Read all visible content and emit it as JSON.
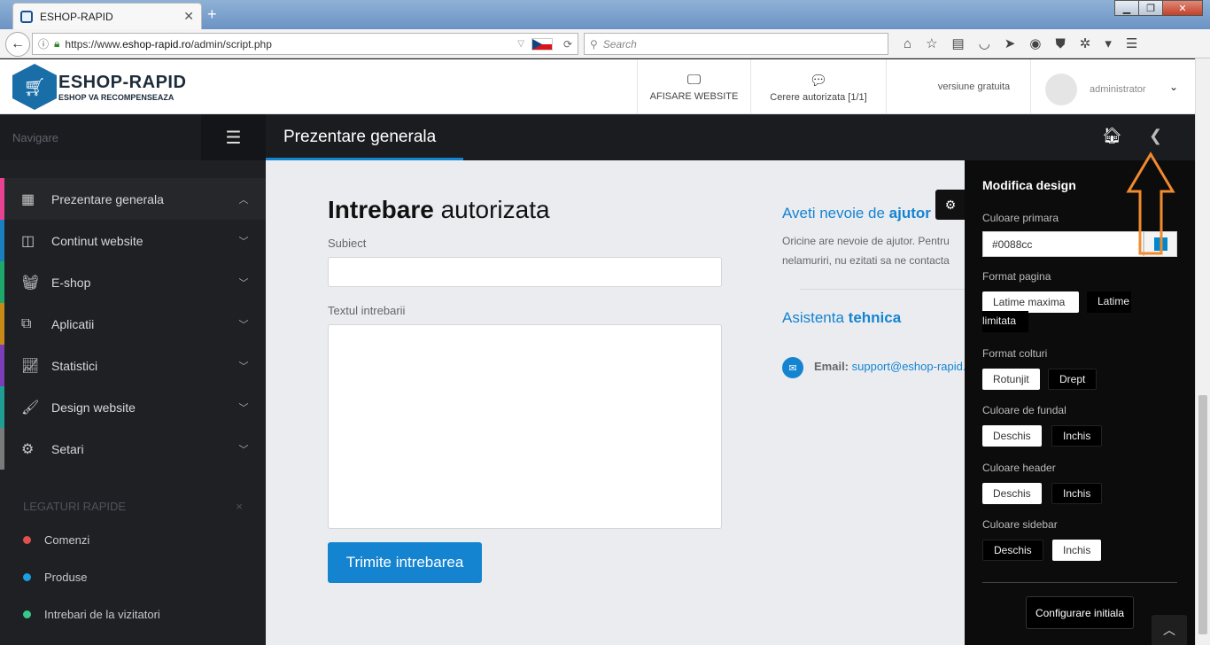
{
  "browser": {
    "tab_title": "ESHOP-RAPID",
    "url_prefix": "https://www.",
    "url_domain": "eshop-rapid.ro",
    "url_path": "/admin/script.php",
    "search_placeholder": "Search"
  },
  "header": {
    "logo_title": "ESHOP-RAPID",
    "logo_subtitle": "ESHOP VA RECOMPENSEAZA",
    "btn_site": "AFISARE WEBSITE",
    "btn_request": "Cerere autorizata [1/1]",
    "version": "versiune gratuita",
    "user": "administrator"
  },
  "sidebar": {
    "nav_label": "Navigare",
    "items": [
      {
        "label": "Prezentare generala",
        "color": "#e84393",
        "icon": "grid-icon"
      },
      {
        "label": "Continut website",
        "color": "#1a7fbf",
        "icon": "columns-icon"
      },
      {
        "label": "E-shop",
        "color": "#1ea86b",
        "icon": "basket-icon"
      },
      {
        "label": "Aplicatii",
        "color": "#c98a18",
        "icon": "cubes-icon"
      },
      {
        "label": "Statistici",
        "color": "#7a3fb8",
        "icon": "chart-icon"
      },
      {
        "label": "Design website",
        "color": "#1f9e93",
        "icon": "brush-icon"
      },
      {
        "label": "Setari",
        "color": "#7a7a7a",
        "icon": "gears-icon"
      }
    ],
    "quick_title": "LEGATURI RAPIDE",
    "quick_close": "×",
    "quick_links": [
      {
        "label": "Comenzi",
        "color": "#e05050"
      },
      {
        "label": "Produse",
        "color": "#1a9fe0"
      },
      {
        "label": "Intrebari de la vizitatori",
        "color": "#38c98a"
      }
    ]
  },
  "page": {
    "title": "Prezentare generala"
  },
  "form": {
    "title_bold": "Intrebare",
    "title_rest": " autorizata",
    "subject_label": "Subiect",
    "text_label": "Textul intrebarii",
    "submit": "Trimite intrebarea"
  },
  "help": {
    "title_pre": "Aveti nevoie de ",
    "title_bold": "ajutor",
    "text": "Oricine are nevoie de ajutor. Pentru nelamuriri, nu ezitati sa ne contacta",
    "tech_pre": "Asistenta ",
    "tech_bold": "tehnica",
    "email_label": "Email:",
    "email": "support@eshop-rapid."
  },
  "design": {
    "title": "Modifica design",
    "primary_label": "Culoare primara",
    "primary_value": "#0088cc",
    "format_label": "Format pagina",
    "format_opts": [
      "Latime maxima",
      "Latime limitata"
    ],
    "corners_label": "Format colturi",
    "corners_opts": [
      "Rotunjit",
      "Drept"
    ],
    "bg_label": "Culoare de fundal",
    "bg_opts": [
      "Deschis",
      "Inchis"
    ],
    "header_label": "Culoare header",
    "header_opts": [
      "Deschis",
      "Inchis"
    ],
    "sidebar_label": "Culoare sidebar",
    "sidebar_opts": [
      "Deschis",
      "Inchis"
    ],
    "reset": "Configurare initiala"
  }
}
